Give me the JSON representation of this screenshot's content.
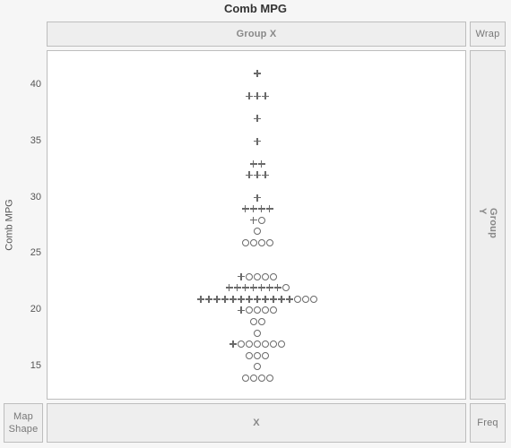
{
  "title": "Comb MPG",
  "panels": {
    "groupx": "Group X",
    "wrap": "Wrap",
    "groupy": "Group Y",
    "mapshape": "Map\nShape",
    "x": "X",
    "freq": "Freq"
  },
  "ylabel": "Comb MPG",
  "yticks": [
    15,
    20,
    25,
    30,
    35,
    40
  ],
  "chart_data": {
    "type": "scatter",
    "title": "Comb MPG",
    "ylabel": "Comb MPG",
    "xlabel": "X",
    "ylim": [
      12,
      43
    ],
    "series": [
      {
        "name": "plus",
        "marker": "plus",
        "points": [
          {
            "y": 41,
            "n": 1
          },
          {
            "y": 39,
            "n": 3
          },
          {
            "y": 37,
            "n": 1
          },
          {
            "y": 35,
            "n": 1
          },
          {
            "y": 33,
            "n": 2
          },
          {
            "y": 32,
            "n": 3
          },
          {
            "y": 30,
            "n": 1
          },
          {
            "y": 29,
            "n": 4
          },
          {
            "y": 28,
            "n": 1
          },
          {
            "y": 23,
            "n": 1
          },
          {
            "y": 22,
            "n": 7
          },
          {
            "y": 21,
            "n": 12
          },
          {
            "y": 20,
            "n": 1
          },
          {
            "y": 17,
            "n": 1
          }
        ]
      },
      {
        "name": "circle",
        "marker": "circle",
        "points": [
          {
            "y": 28,
            "n": 1
          },
          {
            "y": 27,
            "n": 1
          },
          {
            "y": 26,
            "n": 4
          },
          {
            "y": 23,
            "n": 4
          },
          {
            "y": 22,
            "n": 1
          },
          {
            "y": 21,
            "n": 3
          },
          {
            "y": 20,
            "n": 4
          },
          {
            "y": 19,
            "n": 2
          },
          {
            "y": 18,
            "n": 1
          },
          {
            "y": 17,
            "n": 6
          },
          {
            "y": 16,
            "n": 3
          },
          {
            "y": 15,
            "n": 1
          },
          {
            "y": 14,
            "n": 4
          }
        ]
      }
    ]
  }
}
